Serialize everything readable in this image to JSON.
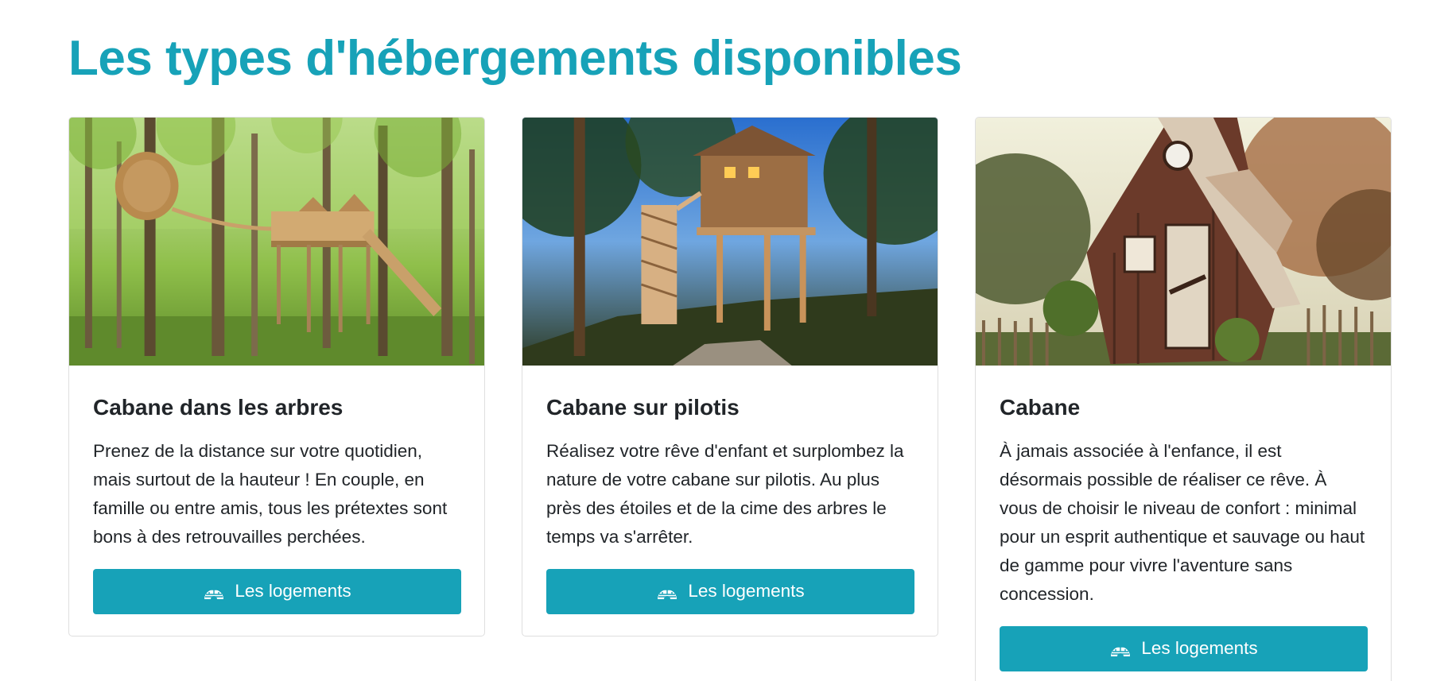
{
  "heading": "Les types d'hébergements disponibles",
  "accent_color": "#17a2b8",
  "cards": [
    {
      "title": "Cabane dans les arbres",
      "text": "Prenez de la distance sur votre quotidien, mais surtout de la hauteur ! En couple, en famille ou entre amis, tous les prétextes sont bons à des retrouvailles perchées.",
      "button_label": "Les logements",
      "button_icon": "igloo-icon"
    },
    {
      "title": "Cabane sur pilotis",
      "text": "Réalisez votre rêve d'enfant et surplombez la nature de votre cabane sur pilotis. Au plus près des étoiles et de la cime des arbres le temps va s'arrêter.",
      "button_label": "Les logements",
      "button_icon": "igloo-icon"
    },
    {
      "title": "Cabane",
      "text": "À jamais associée à l'enfance, il est désormais possible de réaliser ce rêve. À vous de choisir le niveau de confort : minimal pour un esprit authentique et sauvage ou haut de gamme pour vivre l'aventure sans concession.",
      "button_label": "Les logements",
      "button_icon": "igloo-icon"
    }
  ]
}
